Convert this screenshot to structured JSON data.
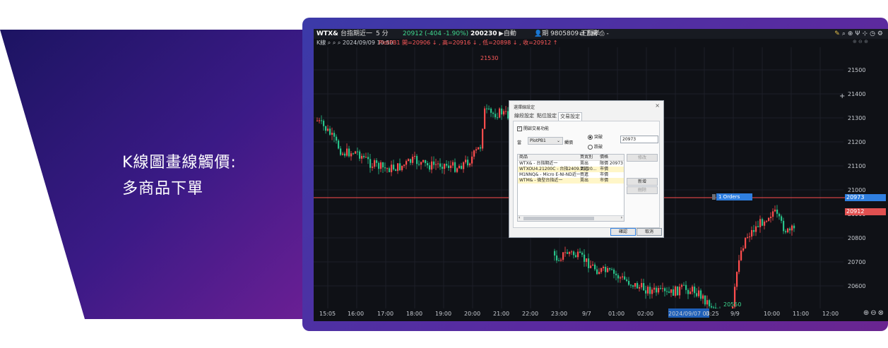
{
  "caption": {
    "line1": "K線圖畫線觸價:",
    "line2": "多商品下單"
  },
  "colors": {
    "banner_dark": "#2a1a6e",
    "banner_purple": "#5b1f8c",
    "chart_bg": "#0f1116",
    "up": "#ff4d4d",
    "down": "#28c38a",
    "line_accent": "#2f7fe0"
  },
  "toolbar": {
    "symbol": "WTX&",
    "name": "台指期近一",
    "interval": "5 分",
    "price": "20912",
    "change": "(-404 -1.90%)",
    "volume": "200230",
    "auto_label": "自動",
    "account": "期 9805809 王磊孝",
    "order_label": "下單",
    "extra": "-",
    "icons": [
      "draw-icon",
      "magnify-icon",
      "zoom-in-icon",
      "indicator-icon",
      "crosshair-icon",
      "clock-icon",
      "settings-icon"
    ]
  },
  "infobar": {
    "label": "K線",
    "datetime": "2024/09/09 10:50",
    "indicator": "PlotPB1 開=20906 ↓ , 高=20916 ↓ , 低=20898 ↓ , 收=20912 ↑"
  },
  "chart": {
    "high_label": "21530",
    "low_label": "20550",
    "y_ticks": [
      "21500",
      "21400",
      "21300",
      "21200",
      "21100",
      "21000",
      "20900",
      "20800",
      "20700",
      "20600"
    ],
    "x_ticks": [
      "15:05",
      "16:00",
      "17:00",
      "18:00",
      "19:00",
      "20:00",
      "21:00",
      "22:00",
      "23:00",
      "9/7",
      "01:00",
      "02:00",
      "2024/09/07 03:25",
      "0",
      "9/9",
      "10:00",
      "11:00",
      "12:00"
    ],
    "tag_blue": "20973",
    "tag_red": "20912",
    "orders_tag": "1 Orders"
  },
  "dialog": {
    "title": "選擇線設定",
    "close": "×",
    "tabs": [
      "線段設定",
      "點位設定",
      "交易設定"
    ],
    "active_tab": "交易設定",
    "checkbox_label": "開啟交易功能",
    "when_label": "當",
    "indicator_select": "PlotPB1",
    "cross_label": "觸價",
    "radio_cross": "突破",
    "radio_fall": "跌破",
    "price_value": "20973",
    "table_headers": [
      "商品",
      "買賣別",
      "價格"
    ],
    "table_rows": [
      {
        "product": "WTX& - 台指期近一",
        "side": "賣出",
        "price": "限價 20973"
      },
      {
        "product": "WTXOU4.21200C - 台指2409.21.20...",
        "side": "買進",
        "price": "市價"
      },
      {
        "product": "M1NNQ& - Micro E-NI-ND近一",
        "side": "買進",
        "price": "市價"
      },
      {
        "product": "WTM& - 微型台指近一",
        "side": "賣出",
        "price": "市價"
      }
    ],
    "btn_modify": "修改",
    "btn_add": "新增",
    "btn_delete": "刪除",
    "btn_ok": "確認",
    "btn_cancel": "取消"
  }
}
